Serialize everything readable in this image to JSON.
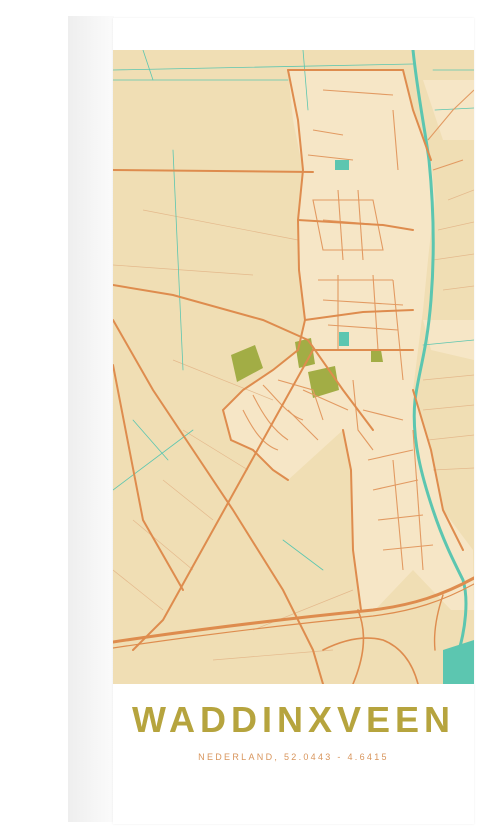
{
  "poster": {
    "city": "WADDINXVEEN",
    "coordinates": "NEDERLAND, 52.0443 - 4.6415"
  },
  "map_style": {
    "background": "#f0deb4",
    "urban_area": "#f6e6c6",
    "major_road": "#de8c4e",
    "minor_road": "#e29a62",
    "water": "#5cc6b0",
    "park": "#a2ad45",
    "title_color": "#b6a43e",
    "subtitle_color": "#d8955c",
    "frame": "#ffffff"
  },
  "map_features": {
    "roads": "road-network",
    "water": "canal",
    "green": "park"
  }
}
